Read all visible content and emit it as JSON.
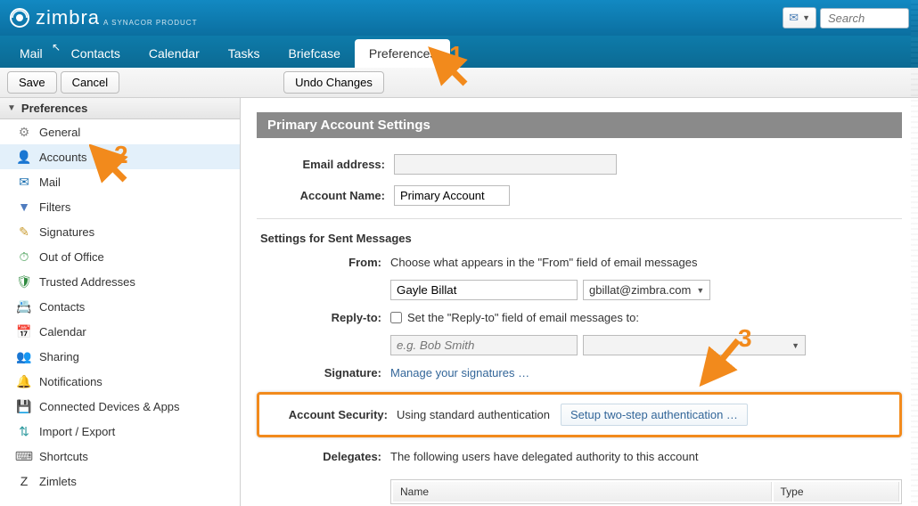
{
  "brand": {
    "name": "zimbra",
    "tagline": "A SYNACOR PRODUCT"
  },
  "search": {
    "placeholder": "Search"
  },
  "tabs": {
    "mail": "Mail",
    "contacts": "Contacts",
    "calendar": "Calendar",
    "tasks": "Tasks",
    "briefcase": "Briefcase",
    "preferences": "Preferences"
  },
  "toolbar": {
    "save": "Save",
    "cancel": "Cancel",
    "undo": "Undo Changes"
  },
  "sidebar": {
    "header": "Preferences",
    "items": [
      {
        "label": "General",
        "icon": "⚙",
        "cls": "ic-general"
      },
      {
        "label": "Accounts",
        "icon": "👤",
        "cls": "ic-accounts"
      },
      {
        "label": "Mail",
        "icon": "✉",
        "cls": "ic-mail"
      },
      {
        "label": "Filters",
        "icon": "▼",
        "cls": "ic-filters"
      },
      {
        "label": "Signatures",
        "icon": "✎",
        "cls": "ic-sign"
      },
      {
        "label": "Out of Office",
        "icon": "⏱",
        "cls": "ic-ooo"
      },
      {
        "label": "Trusted Addresses",
        "icon": "🛡",
        "cls": "ic-trust"
      },
      {
        "label": "Contacts",
        "icon": "📇",
        "cls": "ic-contacts"
      },
      {
        "label": "Calendar",
        "icon": "📅",
        "cls": "ic-cal"
      },
      {
        "label": "Sharing",
        "icon": "👥",
        "cls": "ic-share"
      },
      {
        "label": "Notifications",
        "icon": "🔔",
        "cls": "ic-notif"
      },
      {
        "label": "Connected Devices & Apps",
        "icon": "💾",
        "cls": "ic-devices"
      },
      {
        "label": "Import / Export",
        "icon": "⇅",
        "cls": "ic-import"
      },
      {
        "label": "Shortcuts",
        "icon": "⌨",
        "cls": "ic-short"
      },
      {
        "label": "Zimlets",
        "icon": "Z",
        "cls": "ic-zim"
      }
    ]
  },
  "content": {
    "panel_title": "Primary Account Settings",
    "email_label": "Email address:",
    "email_value": "",
    "account_name_label": "Account Name:",
    "account_name_value": "Primary Account",
    "sent_section": "Settings for Sent Messages",
    "from_label": "From:",
    "from_help": "Choose what appears in the \"From\" field of email messages",
    "from_name": "Gayle Billat",
    "from_email": "gbillat@zimbra.com",
    "replyto_label": "Reply-to:",
    "replyto_check": "Set the \"Reply-to\" field of email messages to:",
    "replyto_placeholder": "e.g. Bob Smith",
    "signature_label": "Signature:",
    "signature_link": "Manage your signatures …",
    "security_label": "Account Security:",
    "security_status": "Using standard authentication",
    "security_link": "Setup two-step authentication …",
    "delegates_label": "Delegates:",
    "delegates_help": "The following users have delegated authority to this account",
    "delegates_cols": {
      "name": "Name",
      "type": "Type"
    }
  },
  "annotations": {
    "n1": "1",
    "n2": "2",
    "n3": "3"
  }
}
